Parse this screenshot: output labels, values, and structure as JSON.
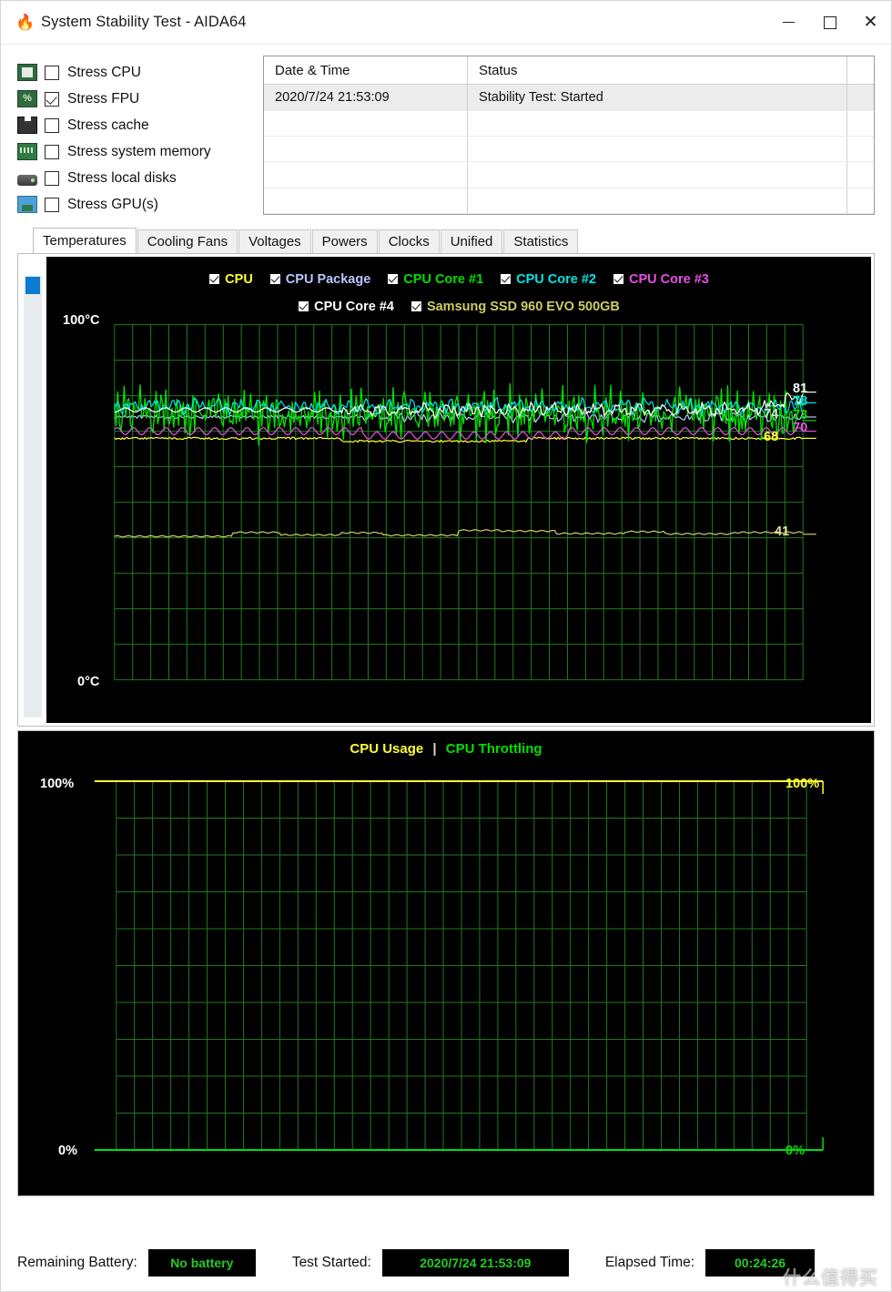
{
  "window": {
    "title": "System Stability Test - AIDA64",
    "app_icon": "flame-icon",
    "minimize_label": "–",
    "maximize_label": "□",
    "close_label": "✕"
  },
  "stress_options": [
    {
      "label": "Stress CPU",
      "checked": false,
      "icon": "cpu-chip-icon"
    },
    {
      "label": "Stress FPU",
      "checked": true,
      "icon": "fpu-chip-icon"
    },
    {
      "label": "Stress cache",
      "checked": false,
      "icon": "cache-module-icon"
    },
    {
      "label": "Stress system memory",
      "checked": false,
      "icon": "memory-stick-icon"
    },
    {
      "label": "Stress local disks",
      "checked": false,
      "icon": "hard-disk-icon"
    },
    {
      "label": "Stress GPU(s)",
      "checked": false,
      "icon": "gpu-monitor-icon"
    }
  ],
  "log": {
    "columns": [
      "Date & Time",
      "Status"
    ],
    "rows": [
      {
        "datetime": "2020/7/24 21:53:09",
        "status": "Stability Test: Started",
        "selected": true
      },
      {
        "datetime": "",
        "status": "",
        "selected": false
      },
      {
        "datetime": "",
        "status": "",
        "selected": false
      },
      {
        "datetime": "",
        "status": "",
        "selected": false
      },
      {
        "datetime": "",
        "status": "",
        "selected": false
      }
    ]
  },
  "tabs": [
    {
      "label": "Temperatures",
      "active": true
    },
    {
      "label": "Cooling Fans",
      "active": false
    },
    {
      "label": "Voltages",
      "active": false
    },
    {
      "label": "Powers",
      "active": false
    },
    {
      "label": "Clocks",
      "active": false
    },
    {
      "label": "Unified",
      "active": false
    },
    {
      "label": "Statistics",
      "active": false
    }
  ],
  "chart_data": [
    {
      "type": "line",
      "title": "Temperatures",
      "ylabel": "",
      "xlabel": "",
      "ylim": [
        0,
        100
      ],
      "y_top_label": "100°C",
      "y_bottom_label": "0°C",
      "grid": true,
      "grid_color": "#1f7a1f",
      "background": "#000000",
      "legend_position": "top",
      "series": [
        {
          "name": "CPU",
          "color": "#ffff33",
          "checked": true,
          "current": 68,
          "mean": 68,
          "min": 67,
          "max": 69,
          "noise": 0.5,
          "style": "flat"
        },
        {
          "name": "CPU Package",
          "color": "#b9c6ff",
          "checked": true,
          "current": 74,
          "mean": 74,
          "min": 71,
          "max": 77,
          "noise": 1.5,
          "style": "wavy"
        },
        {
          "name": "CPU Core #1",
          "color": "#00e000",
          "checked": true,
          "current": 73,
          "mean": 75,
          "min": 68,
          "max": 82,
          "noise": 5.5,
          "style": "spiky"
        },
        {
          "name": "CPU Core #2",
          "color": "#00e5e5",
          "checked": true,
          "current": 78,
          "mean": 77,
          "min": 74,
          "max": 80,
          "noise": 2.2,
          "style": "wavy"
        },
        {
          "name": "CPU Core #3",
          "color": "#e54fe5",
          "checked": true,
          "current": 70,
          "mean": 70,
          "min": 68,
          "max": 72,
          "noise": 1.2,
          "style": "ripple"
        },
        {
          "name": "CPU Core #4",
          "color": "#ffffff",
          "checked": true,
          "current": 81,
          "mean": 76,
          "min": 72,
          "max": 81,
          "noise": 2.0,
          "style": "wavy"
        },
        {
          "name": "Samsung SSD 960 EVO 500GB",
          "color": "#cccc66",
          "checked": true,
          "current": 41,
          "mean": 41,
          "min": 40,
          "max": 42,
          "noise": 0.4,
          "style": "step"
        }
      ],
      "value_labels": [
        {
          "value": 81,
          "color": "#ffffff",
          "series": "CPU Core #4"
        },
        {
          "value": 78,
          "color": "#00e5e5",
          "series": "CPU Core #2"
        },
        {
          "value": 74,
          "color": "#dcdcdc",
          "series": "CPU Package"
        },
        {
          "value": 73,
          "color": "#00e000",
          "series": "CPU Core #1"
        },
        {
          "value": 70,
          "color": "#e54fe5",
          "series": "CPU Core #3"
        },
        {
          "value": 68,
          "color": "#ffff33",
          "series": "CPU"
        },
        {
          "value": 41,
          "color": "#e2e2a0",
          "series": "Samsung SSD 960 EVO 500GB"
        }
      ]
    },
    {
      "type": "line",
      "title_left": "CPU Usage",
      "title_sep": "|",
      "title_right": "CPU Throttling",
      "title_left_color": "#ffff33",
      "title_right_color": "#00e000",
      "ylim": [
        0,
        100
      ],
      "y_top_left": "100%",
      "y_bottom_left": "0%",
      "y_top_right": "100%",
      "y_bottom_right": "0%",
      "grid": true,
      "grid_color": "#1f7a1f",
      "background": "#000000",
      "series": [
        {
          "name": "CPU Usage",
          "color": "#ffff33",
          "constant": 100
        },
        {
          "name": "CPU Throttling",
          "color": "#00e000",
          "constant": 0
        }
      ]
    }
  ],
  "status_bar": {
    "battery_label": "Remaining Battery:",
    "battery_value": "No battery",
    "started_label": "Test Started:",
    "started_value": "2020/7/24 21:53:09",
    "elapsed_label": "Elapsed Time:",
    "elapsed_value": "00:24:26",
    "value_color": "#22cc22"
  },
  "watermark": "什么值得买"
}
